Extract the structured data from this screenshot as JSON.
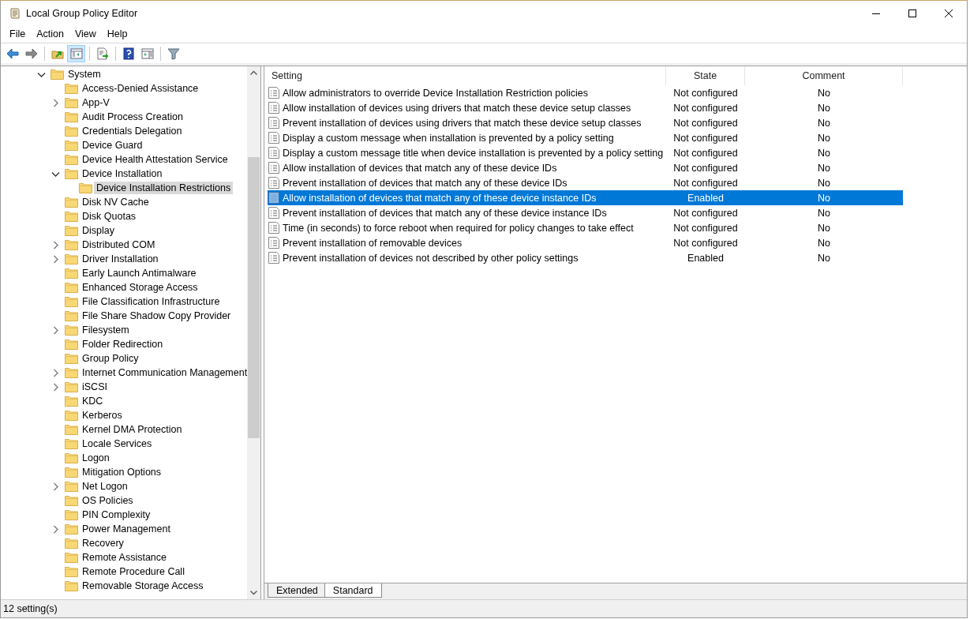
{
  "window": {
    "title": "Local Group Policy Editor"
  },
  "menu": [
    "File",
    "Action",
    "View",
    "Help"
  ],
  "toolbar": [
    {
      "kind": "back",
      "selected": false
    },
    {
      "kind": "forward",
      "selected": false
    },
    {
      "kind": "up",
      "selected": false
    },
    {
      "kind": "tree",
      "selected": true
    },
    {
      "kind": "export",
      "selected": false
    },
    {
      "kind": "help",
      "selected": false
    },
    {
      "kind": "pane",
      "selected": false
    },
    {
      "kind": "filter",
      "selected": false
    }
  ],
  "tree": [
    {
      "label": "System",
      "kind": "branch",
      "expanded": true,
      "selected": false,
      "children": [
        {
          "label": "Access-Denied Assistance",
          "kind": "leaf",
          "selected": false
        },
        {
          "label": "App-V",
          "kind": "branch",
          "expanded": false,
          "selected": false
        },
        {
          "label": "Audit Process Creation",
          "kind": "leaf",
          "selected": false
        },
        {
          "label": "Credentials Delegation",
          "kind": "leaf",
          "selected": false
        },
        {
          "label": "Device Guard",
          "kind": "leaf",
          "selected": false
        },
        {
          "label": "Device Health Attestation Service",
          "kind": "leaf",
          "selected": false
        },
        {
          "label": "Device Installation",
          "kind": "branch",
          "expanded": true,
          "selected": false,
          "children": [
            {
              "label": "Device Installation Restrictions",
              "kind": "leaf",
              "selected": true
            }
          ]
        },
        {
          "label": "Disk NV Cache",
          "kind": "leaf",
          "selected": false
        },
        {
          "label": "Disk Quotas",
          "kind": "leaf",
          "selected": false
        },
        {
          "label": "Display",
          "kind": "leaf",
          "selected": false
        },
        {
          "label": "Distributed COM",
          "kind": "branch",
          "expanded": false,
          "selected": false
        },
        {
          "label": "Driver Installation",
          "kind": "branch",
          "expanded": false,
          "selected": false
        },
        {
          "label": "Early Launch Antimalware",
          "kind": "leaf",
          "selected": false
        },
        {
          "label": "Enhanced Storage Access",
          "kind": "leaf",
          "selected": false
        },
        {
          "label": "File Classification Infrastructure",
          "kind": "leaf",
          "selected": false
        },
        {
          "label": "File Share Shadow Copy Provider",
          "kind": "leaf",
          "selected": false
        },
        {
          "label": "Filesystem",
          "kind": "branch",
          "expanded": false,
          "selected": false
        },
        {
          "label": "Folder Redirection",
          "kind": "leaf",
          "selected": false
        },
        {
          "label": "Group Policy",
          "kind": "leaf",
          "selected": false
        },
        {
          "label": "Internet Communication Management",
          "kind": "branch",
          "expanded": false,
          "selected": false
        },
        {
          "label": "iSCSI",
          "kind": "branch",
          "expanded": false,
          "selected": false
        },
        {
          "label": "KDC",
          "kind": "leaf",
          "selected": false
        },
        {
          "label": "Kerberos",
          "kind": "leaf",
          "selected": false
        },
        {
          "label": "Kernel DMA Protection",
          "kind": "leaf",
          "selected": false
        },
        {
          "label": "Locale Services",
          "kind": "leaf",
          "selected": false
        },
        {
          "label": "Logon",
          "kind": "leaf",
          "selected": false
        },
        {
          "label": "Mitigation Options",
          "kind": "leaf",
          "selected": false
        },
        {
          "label": "Net Logon",
          "kind": "branch",
          "expanded": false,
          "selected": false
        },
        {
          "label": "OS Policies",
          "kind": "leaf",
          "selected": false
        },
        {
          "label": "PIN Complexity",
          "kind": "leaf",
          "selected": false
        },
        {
          "label": "Power Management",
          "kind": "branch",
          "expanded": false,
          "selected": false
        },
        {
          "label": "Recovery",
          "kind": "leaf",
          "selected": false
        },
        {
          "label": "Remote Assistance",
          "kind": "leaf",
          "selected": false
        },
        {
          "label": "Remote Procedure Call",
          "kind": "leaf",
          "selected": false
        },
        {
          "label": "Removable Storage Access",
          "kind": "leaf",
          "selected": false
        }
      ]
    }
  ],
  "table": {
    "columns": [
      "Setting",
      "State",
      "Comment"
    ],
    "rows": [
      {
        "setting": "Allow administrators to override Device Installation Restriction policies",
        "state": "Not configured",
        "comment": "No",
        "selected": false
      },
      {
        "setting": "Allow installation of devices using drivers that match these device setup classes",
        "state": "Not configured",
        "comment": "No",
        "selected": false
      },
      {
        "setting": "Prevent installation of devices using drivers that match these device setup classes",
        "state": "Not configured",
        "comment": "No",
        "selected": false
      },
      {
        "setting": "Display a custom message when installation is prevented by a policy setting",
        "state": "Not configured",
        "comment": "No",
        "selected": false
      },
      {
        "setting": "Display a custom message title when device installation is prevented by a policy setting",
        "state": "Not configured",
        "comment": "No",
        "selected": false
      },
      {
        "setting": "Allow installation of devices that match any of these device IDs",
        "state": "Not configured",
        "comment": "No",
        "selected": false
      },
      {
        "setting": "Prevent installation of devices that match any of these device IDs",
        "state": "Not configured",
        "comment": "No",
        "selected": false
      },
      {
        "setting": "Allow installation of devices that match any of these device instance IDs",
        "state": "Enabled",
        "comment": "No",
        "selected": true
      },
      {
        "setting": "Prevent installation of devices that match any of these device instance IDs",
        "state": "Not configured",
        "comment": "No",
        "selected": false
      },
      {
        "setting": "Time (in seconds) to force reboot when required for policy changes to take effect",
        "state": "Not configured",
        "comment": "No",
        "selected": false
      },
      {
        "setting": "Prevent installation of removable devices",
        "state": "Not configured",
        "comment": "No",
        "selected": false
      },
      {
        "setting": "Prevent installation of devices not described by other policy settings",
        "state": "Enabled",
        "comment": "No",
        "selected": false
      }
    ]
  },
  "view_tabs": [
    {
      "label": "Extended",
      "selected": false
    },
    {
      "label": "Standard",
      "selected": true
    }
  ],
  "status_bar": "12 setting(s)"
}
